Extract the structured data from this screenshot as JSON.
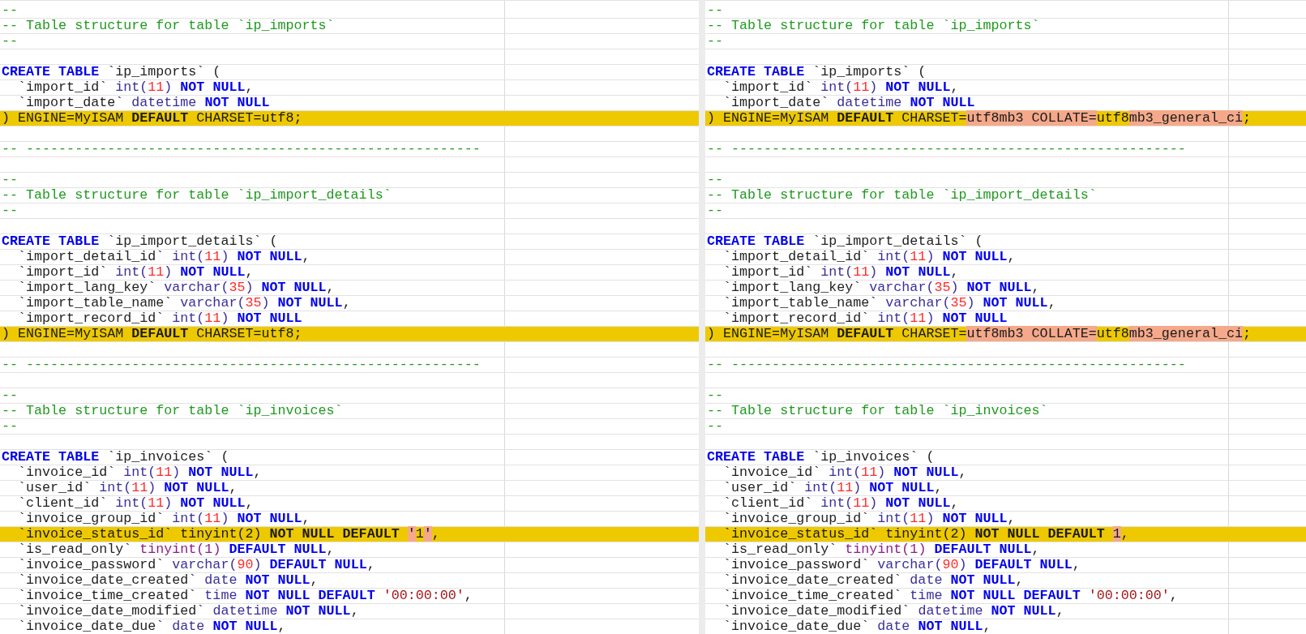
{
  "rows": [
    {
      "changed": false,
      "left": [
        {
          "kind": "comment",
          "text": "--"
        }
      ],
      "right": [
        {
          "kind": "comment",
          "text": "--"
        }
      ]
    },
    {
      "changed": false,
      "left": [
        {
          "kind": "comment",
          "text": "-- Table structure for table `ip_imports`"
        }
      ],
      "right": [
        {
          "kind": "comment",
          "text": "-- Table structure for table `ip_imports`"
        }
      ]
    },
    {
      "changed": false,
      "left": [
        {
          "kind": "comment",
          "text": "--"
        }
      ],
      "right": [
        {
          "kind": "comment",
          "text": "--"
        }
      ]
    },
    {
      "changed": false
    },
    {
      "changed": false,
      "left": [
        {
          "kind": "keyword",
          "text": "CREATE TABLE"
        },
        {
          "kind": "plain",
          "text": " `ip_imports` ("
        }
      ],
      "right": [
        {
          "kind": "keyword",
          "text": "CREATE TABLE"
        },
        {
          "kind": "plain",
          "text": " `ip_imports` ("
        }
      ]
    },
    {
      "changed": false,
      "left": [
        {
          "kind": "plain",
          "text": "  `import_id` "
        },
        {
          "kind": "type",
          "text": "int("
        },
        {
          "kind": "number",
          "text": "11"
        },
        {
          "kind": "type",
          "text": ") "
        },
        {
          "kind": "keyword",
          "text": "NOT NULL"
        },
        {
          "kind": "plain",
          "text": ","
        }
      ],
      "right": [
        {
          "kind": "plain",
          "text": "  `import_id` "
        },
        {
          "kind": "type",
          "text": "int("
        },
        {
          "kind": "number",
          "text": "11"
        },
        {
          "kind": "type",
          "text": ") "
        },
        {
          "kind": "keyword",
          "text": "NOT NULL"
        },
        {
          "kind": "plain",
          "text": ","
        }
      ]
    },
    {
      "changed": false,
      "left": [
        {
          "kind": "plain",
          "text": "  `import_date` "
        },
        {
          "kind": "type",
          "text": "datetime "
        },
        {
          "kind": "keyword",
          "text": "NOT NULL"
        }
      ],
      "right": [
        {
          "kind": "plain",
          "text": "  `import_date` "
        },
        {
          "kind": "type",
          "text": "datetime "
        },
        {
          "kind": "keyword",
          "text": "NOT NULL"
        }
      ]
    },
    {
      "changed": true,
      "left": [
        {
          "kind": "plain",
          "text": ") ENGINE=MyISAM "
        },
        {
          "kind": "keyword",
          "text": "DEFAULT"
        },
        {
          "kind": "plain",
          "text": " CHARSET=utf8;"
        }
      ],
      "right": [
        {
          "kind": "plain",
          "text": ") ENGINE=MyISAM "
        },
        {
          "kind": "keyword",
          "text": "DEFAULT"
        },
        {
          "kind": "plain",
          "text": " CHARSET="
        },
        {
          "kind": "diff",
          "text": "utf8mb3 COLLATE="
        },
        {
          "kind": "plain",
          "text": "utf8"
        },
        {
          "kind": "diff",
          "text": "mb3_general_ci"
        },
        {
          "kind": "plain",
          "text": ";"
        }
      ]
    },
    {
      "changed": false
    },
    {
      "changed": false,
      "left": [
        {
          "kind": "comment",
          "text": "-- --------------------------------------------------------"
        }
      ],
      "right": [
        {
          "kind": "comment",
          "text": "-- --------------------------------------------------------"
        }
      ]
    },
    {
      "changed": false
    },
    {
      "changed": false,
      "left": [
        {
          "kind": "comment",
          "text": "--"
        }
      ],
      "right": [
        {
          "kind": "comment",
          "text": "--"
        }
      ]
    },
    {
      "changed": false,
      "left": [
        {
          "kind": "comment",
          "text": "-- Table structure for table `ip_import_details`"
        }
      ],
      "right": [
        {
          "kind": "comment",
          "text": "-- Table structure for table `ip_import_details`"
        }
      ]
    },
    {
      "changed": false,
      "left": [
        {
          "kind": "comment",
          "text": "--"
        }
      ],
      "right": [
        {
          "kind": "comment",
          "text": "--"
        }
      ]
    },
    {
      "changed": false
    },
    {
      "changed": false,
      "left": [
        {
          "kind": "keyword",
          "text": "CREATE TABLE"
        },
        {
          "kind": "plain",
          "text": " `ip_import_details` ("
        }
      ],
      "right": [
        {
          "kind": "keyword",
          "text": "CREATE TABLE"
        },
        {
          "kind": "plain",
          "text": " `ip_import_details` ("
        }
      ]
    },
    {
      "changed": false,
      "left": [
        {
          "kind": "plain",
          "text": "  `import_detail_id` "
        },
        {
          "kind": "type",
          "text": "int("
        },
        {
          "kind": "number",
          "text": "11"
        },
        {
          "kind": "type",
          "text": ") "
        },
        {
          "kind": "keyword",
          "text": "NOT NULL"
        },
        {
          "kind": "plain",
          "text": ","
        }
      ],
      "right": [
        {
          "kind": "plain",
          "text": "  `import_detail_id` "
        },
        {
          "kind": "type",
          "text": "int("
        },
        {
          "kind": "number",
          "text": "11"
        },
        {
          "kind": "type",
          "text": ") "
        },
        {
          "kind": "keyword",
          "text": "NOT NULL"
        },
        {
          "kind": "plain",
          "text": ","
        }
      ]
    },
    {
      "changed": false,
      "left": [
        {
          "kind": "plain",
          "text": "  `import_id` "
        },
        {
          "kind": "type",
          "text": "int("
        },
        {
          "kind": "number",
          "text": "11"
        },
        {
          "kind": "type",
          "text": ") "
        },
        {
          "kind": "keyword",
          "text": "NOT NULL"
        },
        {
          "kind": "plain",
          "text": ","
        }
      ],
      "right": [
        {
          "kind": "plain",
          "text": "  `import_id` "
        },
        {
          "kind": "type",
          "text": "int("
        },
        {
          "kind": "number",
          "text": "11"
        },
        {
          "kind": "type",
          "text": ") "
        },
        {
          "kind": "keyword",
          "text": "NOT NULL"
        },
        {
          "kind": "plain",
          "text": ","
        }
      ]
    },
    {
      "changed": false,
      "left": [
        {
          "kind": "plain",
          "text": "  `import_lang_key` "
        },
        {
          "kind": "type",
          "text": "varchar("
        },
        {
          "kind": "number",
          "text": "35"
        },
        {
          "kind": "type",
          "text": ") "
        },
        {
          "kind": "keyword",
          "text": "NOT NULL"
        },
        {
          "kind": "plain",
          "text": ","
        }
      ],
      "right": [
        {
          "kind": "plain",
          "text": "  `import_lang_key` "
        },
        {
          "kind": "type",
          "text": "varchar("
        },
        {
          "kind": "number",
          "text": "35"
        },
        {
          "kind": "type",
          "text": ") "
        },
        {
          "kind": "keyword",
          "text": "NOT NULL"
        },
        {
          "kind": "plain",
          "text": ","
        }
      ]
    },
    {
      "changed": false,
      "left": [
        {
          "kind": "plain",
          "text": "  `import_table_name` "
        },
        {
          "kind": "type",
          "text": "varchar("
        },
        {
          "kind": "number",
          "text": "35"
        },
        {
          "kind": "type",
          "text": ") "
        },
        {
          "kind": "keyword",
          "text": "NOT NULL"
        },
        {
          "kind": "plain",
          "text": ","
        }
      ],
      "right": [
        {
          "kind": "plain",
          "text": "  `import_table_name` "
        },
        {
          "kind": "type",
          "text": "varchar("
        },
        {
          "kind": "number",
          "text": "35"
        },
        {
          "kind": "type",
          "text": ") "
        },
        {
          "kind": "keyword",
          "text": "NOT NULL"
        },
        {
          "kind": "plain",
          "text": ","
        }
      ]
    },
    {
      "changed": false,
      "left": [
        {
          "kind": "plain",
          "text": "  `import_record_id` "
        },
        {
          "kind": "type",
          "text": "int("
        },
        {
          "kind": "number",
          "text": "11"
        },
        {
          "kind": "type",
          "text": ") "
        },
        {
          "kind": "keyword",
          "text": "NOT NULL"
        }
      ],
      "right": [
        {
          "kind": "plain",
          "text": "  `import_record_id` "
        },
        {
          "kind": "type",
          "text": "int("
        },
        {
          "kind": "number",
          "text": "11"
        },
        {
          "kind": "type",
          "text": ") "
        },
        {
          "kind": "keyword",
          "text": "NOT NULL"
        }
      ]
    },
    {
      "changed": true,
      "left": [
        {
          "kind": "plain",
          "text": ") ENGINE=MyISAM "
        },
        {
          "kind": "keyword",
          "text": "DEFAULT"
        },
        {
          "kind": "plain",
          "text": " CHARSET=utf8;"
        }
      ],
      "right": [
        {
          "kind": "plain",
          "text": ") ENGINE=MyISAM "
        },
        {
          "kind": "keyword",
          "text": "DEFAULT"
        },
        {
          "kind": "plain",
          "text": " CHARSET="
        },
        {
          "kind": "diff",
          "text": "utf8mb3 COLLATE="
        },
        {
          "kind": "plain",
          "text": "utf8"
        },
        {
          "kind": "diff",
          "text": "mb3_general_ci"
        },
        {
          "kind": "plain",
          "text": ";"
        }
      ]
    },
    {
      "changed": false
    },
    {
      "changed": false,
      "left": [
        {
          "kind": "comment",
          "text": "-- --------------------------------------------------------"
        }
      ],
      "right": [
        {
          "kind": "comment",
          "text": "-- --------------------------------------------------------"
        }
      ]
    },
    {
      "changed": false
    },
    {
      "changed": false,
      "left": [
        {
          "kind": "comment",
          "text": "--"
        }
      ],
      "right": [
        {
          "kind": "comment",
          "text": "--"
        }
      ]
    },
    {
      "changed": false,
      "left": [
        {
          "kind": "comment",
          "text": "-- Table structure for table `ip_invoices`"
        }
      ],
      "right": [
        {
          "kind": "comment",
          "text": "-- Table structure for table `ip_invoices`"
        }
      ]
    },
    {
      "changed": false,
      "left": [
        {
          "kind": "comment",
          "text": "--"
        }
      ],
      "right": [
        {
          "kind": "comment",
          "text": "--"
        }
      ]
    },
    {
      "changed": false
    },
    {
      "changed": false,
      "left": [
        {
          "kind": "keyword",
          "text": "CREATE TABLE"
        },
        {
          "kind": "plain",
          "text": " `ip_invoices` ("
        }
      ],
      "right": [
        {
          "kind": "keyword",
          "text": "CREATE TABLE"
        },
        {
          "kind": "plain",
          "text": " `ip_invoices` ("
        }
      ]
    },
    {
      "changed": false,
      "left": [
        {
          "kind": "plain",
          "text": "  `invoice_id` "
        },
        {
          "kind": "type",
          "text": "int("
        },
        {
          "kind": "number",
          "text": "11"
        },
        {
          "kind": "type",
          "text": ") "
        },
        {
          "kind": "keyword",
          "text": "NOT NULL"
        },
        {
          "kind": "plain",
          "text": ","
        }
      ],
      "right": [
        {
          "kind": "plain",
          "text": "  `invoice_id` "
        },
        {
          "kind": "type",
          "text": "int("
        },
        {
          "kind": "number",
          "text": "11"
        },
        {
          "kind": "type",
          "text": ") "
        },
        {
          "kind": "keyword",
          "text": "NOT NULL"
        },
        {
          "kind": "plain",
          "text": ","
        }
      ]
    },
    {
      "changed": false,
      "left": [
        {
          "kind": "plain",
          "text": "  `user_id` "
        },
        {
          "kind": "type",
          "text": "int("
        },
        {
          "kind": "number",
          "text": "11"
        },
        {
          "kind": "type",
          "text": ") "
        },
        {
          "kind": "keyword",
          "text": "NOT NULL"
        },
        {
          "kind": "plain",
          "text": ","
        }
      ],
      "right": [
        {
          "kind": "plain",
          "text": "  `user_id` "
        },
        {
          "kind": "type",
          "text": "int("
        },
        {
          "kind": "number",
          "text": "11"
        },
        {
          "kind": "type",
          "text": ") "
        },
        {
          "kind": "keyword",
          "text": "NOT NULL"
        },
        {
          "kind": "plain",
          "text": ","
        }
      ]
    },
    {
      "changed": false,
      "left": [
        {
          "kind": "plain",
          "text": "  `client_id` "
        },
        {
          "kind": "type",
          "text": "int("
        },
        {
          "kind": "number",
          "text": "11"
        },
        {
          "kind": "type",
          "text": ") "
        },
        {
          "kind": "keyword",
          "text": "NOT NULL"
        },
        {
          "kind": "plain",
          "text": ","
        }
      ],
      "right": [
        {
          "kind": "plain",
          "text": "  `client_id` "
        },
        {
          "kind": "type",
          "text": "int("
        },
        {
          "kind": "number",
          "text": "11"
        },
        {
          "kind": "type",
          "text": ") "
        },
        {
          "kind": "keyword",
          "text": "NOT NULL"
        },
        {
          "kind": "plain",
          "text": ","
        }
      ]
    },
    {
      "changed": false,
      "left": [
        {
          "kind": "plain",
          "text": "  `invoice_group_id` "
        },
        {
          "kind": "type",
          "text": "int("
        },
        {
          "kind": "number",
          "text": "11"
        },
        {
          "kind": "type",
          "text": ") "
        },
        {
          "kind": "keyword",
          "text": "NOT NULL"
        },
        {
          "kind": "plain",
          "text": ","
        }
      ],
      "right": [
        {
          "kind": "plain",
          "text": "  `invoice_group_id` "
        },
        {
          "kind": "type",
          "text": "int("
        },
        {
          "kind": "number",
          "text": "11"
        },
        {
          "kind": "type",
          "text": ") "
        },
        {
          "kind": "keyword",
          "text": "NOT NULL"
        },
        {
          "kind": "plain",
          "text": ","
        }
      ]
    },
    {
      "changed": true,
      "left": [
        {
          "kind": "plain",
          "text": "  `invoice_status_id` tinyint(2) "
        },
        {
          "kind": "keyword",
          "text": "NOT NULL DEFAULT "
        },
        {
          "kind": "diff",
          "text": "'"
        },
        {
          "kind": "plain",
          "text": "1"
        },
        {
          "kind": "diff",
          "text": "'"
        },
        {
          "kind": "plain",
          "text": ","
        }
      ],
      "right": [
        {
          "kind": "plain",
          "text": "  `invoice_status_id` tinyint(2) "
        },
        {
          "kind": "keyword",
          "text": "NOT NULL DEFAULT "
        },
        {
          "kind": "diff",
          "text": "1"
        },
        {
          "kind": "plain",
          "text": ","
        }
      ]
    },
    {
      "changed": false,
      "left": [
        {
          "kind": "plain",
          "text": "  `is_read_only` "
        },
        {
          "kind": "type2",
          "text": "tinyint(1) "
        },
        {
          "kind": "keyword",
          "text": "DEFAULT NULL"
        },
        {
          "kind": "plain",
          "text": ","
        }
      ],
      "right": [
        {
          "kind": "plain",
          "text": "  `is_read_only` "
        },
        {
          "kind": "type2",
          "text": "tinyint(1) "
        },
        {
          "kind": "keyword",
          "text": "DEFAULT NULL"
        },
        {
          "kind": "plain",
          "text": ","
        }
      ]
    },
    {
      "changed": false,
      "left": [
        {
          "kind": "plain",
          "text": "  `invoice_password` "
        },
        {
          "kind": "type",
          "text": "varchar("
        },
        {
          "kind": "number",
          "text": "90"
        },
        {
          "kind": "type",
          "text": ") "
        },
        {
          "kind": "keyword",
          "text": "DEFAULT NULL"
        },
        {
          "kind": "plain",
          "text": ","
        }
      ],
      "right": [
        {
          "kind": "plain",
          "text": "  `invoice_password` "
        },
        {
          "kind": "type",
          "text": "varchar("
        },
        {
          "kind": "number",
          "text": "90"
        },
        {
          "kind": "type",
          "text": ") "
        },
        {
          "kind": "keyword",
          "text": "DEFAULT NULL"
        },
        {
          "kind": "plain",
          "text": ","
        }
      ]
    },
    {
      "changed": false,
      "left": [
        {
          "kind": "plain",
          "text": "  `invoice_date_created` "
        },
        {
          "kind": "type",
          "text": "date "
        },
        {
          "kind": "keyword",
          "text": "NOT NULL"
        },
        {
          "kind": "plain",
          "text": ","
        }
      ],
      "right": [
        {
          "kind": "plain",
          "text": "  `invoice_date_created` "
        },
        {
          "kind": "type",
          "text": "date "
        },
        {
          "kind": "keyword",
          "text": "NOT NULL"
        },
        {
          "kind": "plain",
          "text": ","
        }
      ]
    },
    {
      "changed": false,
      "left": [
        {
          "kind": "plain",
          "text": "  `invoice_time_created` "
        },
        {
          "kind": "type",
          "text": "time "
        },
        {
          "kind": "keyword",
          "text": "NOT NULL DEFAULT "
        },
        {
          "kind": "string",
          "text": "'00:00:00'"
        },
        {
          "kind": "plain",
          "text": ","
        }
      ],
      "right": [
        {
          "kind": "plain",
          "text": "  `invoice_time_created` "
        },
        {
          "kind": "type",
          "text": "time "
        },
        {
          "kind": "keyword",
          "text": "NOT NULL DEFAULT "
        },
        {
          "kind": "string",
          "text": "'00:00:00'"
        },
        {
          "kind": "plain",
          "text": ","
        }
      ]
    },
    {
      "changed": false,
      "left": [
        {
          "kind": "plain",
          "text": "  `invoice_date_modified` "
        },
        {
          "kind": "type",
          "text": "datetime "
        },
        {
          "kind": "keyword",
          "text": "NOT NULL"
        },
        {
          "kind": "plain",
          "text": ","
        }
      ],
      "right": [
        {
          "kind": "plain",
          "text": "  `invoice_date_modified` "
        },
        {
          "kind": "type",
          "text": "datetime "
        },
        {
          "kind": "keyword",
          "text": "NOT NULL"
        },
        {
          "kind": "plain",
          "text": ","
        }
      ]
    },
    {
      "changed": false,
      "left": [
        {
          "kind": "plain",
          "text": "  `invoice_date_due` "
        },
        {
          "kind": "type",
          "text": "date "
        },
        {
          "kind": "keyword",
          "text": "NOT NULL"
        },
        {
          "kind": "plain",
          "text": ","
        }
      ],
      "right": [
        {
          "kind": "plain",
          "text": "  `invoice_date_due` "
        },
        {
          "kind": "type",
          "text": "date "
        },
        {
          "kind": "keyword",
          "text": "NOT NULL"
        },
        {
          "kind": "plain",
          "text": ","
        }
      ]
    }
  ]
}
